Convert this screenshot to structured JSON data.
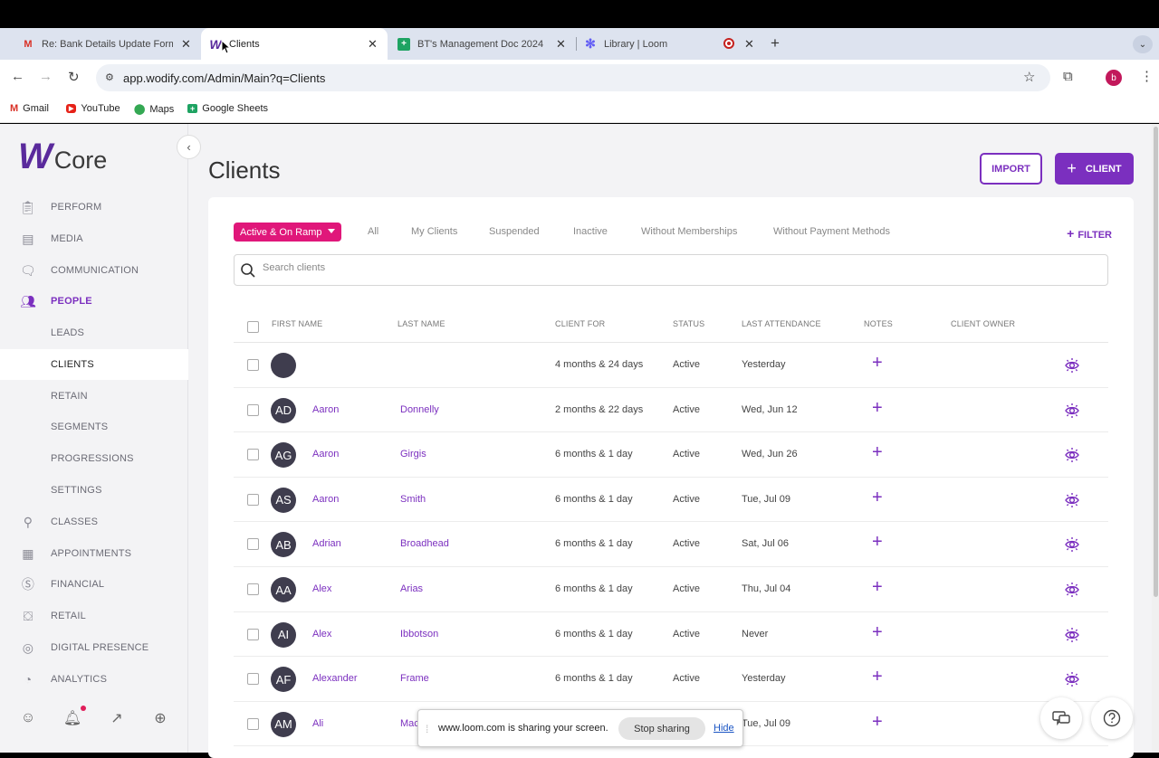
{
  "browser": {
    "tabs": [
      {
        "title": "Re: Bank Details Update Form",
        "favicon": "gmail-icon",
        "active": false
      },
      {
        "title": "Clients",
        "favicon": "wodify-icon",
        "active": true
      },
      {
        "title": "BT's Management Doc 2024",
        "favicon": "sheets-icon",
        "active": false
      },
      {
        "title": "Library | Loom",
        "favicon": "loom-icon",
        "active": false
      }
    ],
    "url": "app.wodify.com/Admin/Main?q=Clients",
    "profile_initial": "b",
    "bookmarks": [
      {
        "label": "Gmail",
        "icon": "gmail-icon"
      },
      {
        "label": "YouTube",
        "icon": "youtube-icon"
      },
      {
        "label": "Maps",
        "icon": "maps-icon"
      },
      {
        "label": "Google Sheets",
        "icon": "sheets-icon"
      }
    ]
  },
  "sidebar": {
    "logo_text": "Core",
    "items": [
      {
        "label": "PERFORM",
        "icon": "clipboard-icon"
      },
      {
        "label": "MEDIA",
        "icon": "media-icon"
      },
      {
        "label": "COMMUNICATION",
        "icon": "chat-icon"
      },
      {
        "label": "PEOPLE",
        "icon": "people-icon"
      },
      {
        "label": "LEADS"
      },
      {
        "label": "CLIENTS"
      },
      {
        "label": "RETAIN"
      },
      {
        "label": "SEGMENTS"
      },
      {
        "label": "PROGRESSIONS"
      },
      {
        "label": "SETTINGS"
      },
      {
        "label": "CLASSES",
        "icon": "classes-icon"
      },
      {
        "label": "APPOINTMENTS",
        "icon": "calendar-icon"
      },
      {
        "label": "FINANCIAL",
        "icon": "dollar-icon"
      },
      {
        "label": "RETAIL",
        "icon": "cart-icon"
      },
      {
        "label": "DIGITAL PRESENCE",
        "icon": "globe-icon"
      },
      {
        "label": "ANALYTICS",
        "icon": "chart-icon"
      }
    ]
  },
  "page": {
    "title": "Clients",
    "import_label": "IMPORT",
    "client_label": "CLIENT"
  },
  "filters": {
    "active": "Active & On Ramp",
    "tabs": [
      "All",
      "My Clients",
      "Suspended",
      "Inactive",
      "Without Memberships",
      "Without Payment Methods"
    ],
    "filter_label": "FILTER"
  },
  "search": {
    "placeholder": "Search clients"
  },
  "table": {
    "columns": [
      "FIRST NAME",
      "LAST NAME",
      "CLIENT FOR",
      "STATUS",
      "LAST ATTENDANCE",
      "NOTES",
      "CLIENT OWNER"
    ],
    "rows": [
      {
        "initials": "",
        "first": "",
        "last": "",
        "client_for": "4 months & 24 days",
        "status": "Active",
        "last_attendance": "Yesterday"
      },
      {
        "initials": "AD",
        "first": "Aaron",
        "last": "Donnelly",
        "client_for": "2 months & 22 days",
        "status": "Active",
        "last_attendance": "Wed, Jun 12"
      },
      {
        "initials": "AG",
        "first": "Aaron",
        "last": "Girgis",
        "client_for": "6 months & 1 day",
        "status": "Active",
        "last_attendance": "Wed, Jun 26"
      },
      {
        "initials": "AS",
        "first": "Aaron",
        "last": "Smith",
        "client_for": "6 months & 1 day",
        "status": "Active",
        "last_attendance": "Tue, Jul 09"
      },
      {
        "initials": "AB",
        "first": "Adrian",
        "last": "Broadhead",
        "client_for": "6 months & 1 day",
        "status": "Active",
        "last_attendance": "Sat, Jul 06"
      },
      {
        "initials": "AA",
        "first": "Alex",
        "last": "Arias",
        "client_for": "6 months & 1 day",
        "status": "Active",
        "last_attendance": "Thu, Jul 04"
      },
      {
        "initials": "AI",
        "first": "Alex",
        "last": "Ibbotson",
        "client_for": "6 months & 1 day",
        "status": "Active",
        "last_attendance": "Never"
      },
      {
        "initials": "AF",
        "first": "Alexander",
        "last": "Frame",
        "client_for": "6 months & 1 day",
        "status": "Active",
        "last_attendance": "Yesterday"
      },
      {
        "initials": "AM",
        "first": "Ali",
        "last": "Mac",
        "client_for": "",
        "status": "",
        "last_attendance": "Tue, Jul 09"
      }
    ],
    "notes_symbol": "+"
  },
  "share_bar": {
    "message": "www.loom.com is sharing your screen.",
    "stop_label": "Stop sharing",
    "hide_label": "Hide"
  },
  "colors": {
    "accent": "#7b2fbf",
    "pill": "#e0177a",
    "avatar": "#3f3d4e"
  }
}
